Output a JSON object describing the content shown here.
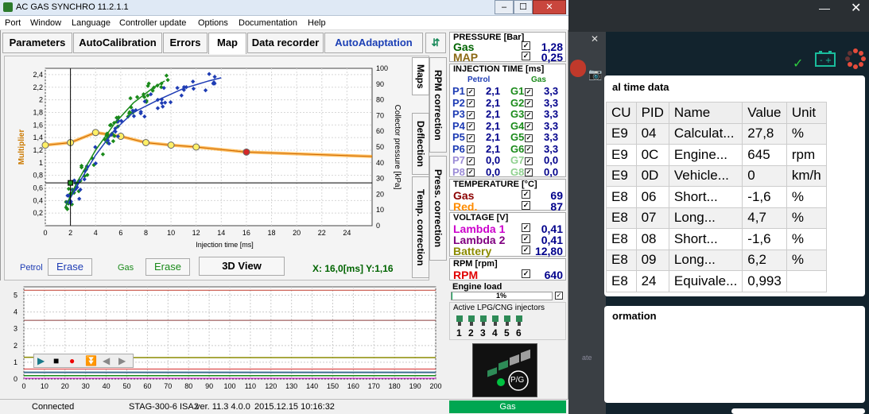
{
  "window": {
    "title": "AC GAS SYNCHRO  11.2.1.1"
  },
  "menu": [
    "Port",
    "Window",
    "Language",
    "Controller update",
    "Options",
    "Documentation",
    "Help"
  ],
  "tabs": [
    "Parameters",
    "AutoCalibration",
    "Errors",
    "Map",
    "Data recorder",
    "AutoAdaptation"
  ],
  "side_tabs": [
    "Maps",
    "RPM correction",
    "Deflection",
    "Press. correction",
    "Temp. correction"
  ],
  "chart_data": {
    "type": "scatter",
    "xlabel": "Injection time [ms]",
    "ylabel_left": "Multiplier",
    "ylabel_right": "Collector pressure [kPa]",
    "xlim": [
      0,
      26
    ],
    "ylim_left": [
      0,
      2.5
    ],
    "ylim_right": [
      0,
      100
    ],
    "x_ticks": [
      0,
      2,
      4,
      6,
      8,
      10,
      12,
      14,
      16,
      18,
      20,
      22,
      24
    ],
    "y_ticks_left": [
      0.2,
      0.4,
      0.6,
      0.8,
      1,
      1.2,
      1.4,
      1.6,
      1.8,
      2,
      2.2,
      2.4
    ],
    "y_ticks_right": [
      0,
      10,
      20,
      30,
      40,
      50,
      60,
      70,
      80,
      90,
      100
    ],
    "multiplier_curve": {
      "x": [
        0,
        2,
        4,
        6,
        8,
        10,
        12,
        16,
        26
      ],
      "y": [
        1.28,
        1.32,
        1.48,
        1.42,
        1.32,
        1.28,
        1.25,
        1.17,
        1.1
      ]
    },
    "petrol_curve": {
      "x": [
        1.6,
        2.5,
        4,
        5.5,
        7,
        9,
        11,
        13,
        14
      ],
      "y": [
        0.3,
        0.62,
        1.12,
        1.52,
        1.8,
        2.0,
        2.18,
        2.3,
        2.35
      ]
    },
    "gas_curve": {
      "x": [
        1.6,
        2.5,
        4,
        5.5,
        7,
        8.5,
        9.5
      ],
      "y": [
        0.3,
        0.68,
        1.2,
        1.62,
        1.95,
        2.18,
        2.3
      ]
    },
    "cursor": {
      "x": 2,
      "y": 0.68
    }
  },
  "chart_controls": {
    "petrol_label": "Petrol",
    "petrol_erase": "Erase",
    "gas_label": "Gas",
    "gas_erase": "Erase",
    "view_3d": "3D View",
    "readout": "X: 16,0[ms] Y:1,16"
  },
  "graph2": {
    "x_ticks": [
      0,
      10,
      20,
      30,
      40,
      50,
      60,
      70,
      80,
      90,
      100,
      110,
      120,
      130,
      140,
      150,
      160,
      170,
      180,
      190,
      200
    ],
    "y_ticks": [
      0,
      1,
      2,
      3,
      4,
      5
    ]
  },
  "pressure": {
    "title": "PRESSURE [Bar]",
    "rows": [
      {
        "label": "Gas",
        "value": "1,28",
        "color": "#006400"
      },
      {
        "label": "MAP",
        "value": "0,25",
        "color": "#8b6914"
      }
    ]
  },
  "injection": {
    "title": "INJECTION TIME [ms]",
    "petrol_label": "Petrol",
    "gas_label": "Gas",
    "rows": [
      {
        "p": "P1",
        "pv": "2,1",
        "g": "G1",
        "gv": "3,3"
      },
      {
        "p": "P2",
        "pv": "2,1",
        "g": "G2",
        "gv": "3,3"
      },
      {
        "p": "P3",
        "pv": "2,1",
        "g": "G3",
        "gv": "3,3"
      },
      {
        "p": "P4",
        "pv": "2,1",
        "g": "G4",
        "gv": "3,3"
      },
      {
        "p": "P5",
        "pv": "2,1",
        "g": "G5",
        "gv": "3,3"
      },
      {
        "p": "P6",
        "pv": "2,1",
        "g": "G6",
        "gv": "3,3"
      },
      {
        "p": "P7",
        "pv": "0,0",
        "g": "G7",
        "gv": "0,0"
      },
      {
        "p": "P8",
        "pv": "0,0",
        "g": "G8",
        "gv": "0,0"
      }
    ]
  },
  "temperature": {
    "title": "TEMPERATURE [°C]",
    "rows": [
      {
        "label": "Gas",
        "value": "69",
        "color": "#8b0000"
      },
      {
        "label": "Red.",
        "value": "87",
        "color": "#ff8c00"
      }
    ]
  },
  "voltage": {
    "title": "VOLTAGE [V]",
    "rows": [
      {
        "label": "Lambda 1",
        "value": "0,41",
        "color": "#cc00cc"
      },
      {
        "label": "Lambda 2",
        "value": "0,41",
        "color": "#800080"
      },
      {
        "label": "Battery",
        "value": "12,80",
        "color": "#8b8b00"
      }
    ]
  },
  "rpm": {
    "title": "RPM [rpm]",
    "label": "RPM",
    "value": "640"
  },
  "engine_load": {
    "title": "Engine load",
    "value": "1%",
    "fraction": 0.01
  },
  "injectors": {
    "title": "Active LPG/CNG injectors",
    "numbers": [
      "1",
      "2",
      "3",
      "4",
      "5",
      "6"
    ]
  },
  "pg_label": "P/G",
  "status": {
    "connected": "Connected",
    "controller": "STAG-300-6 ISA2",
    "version": "ver. 11.3  4.0.0",
    "datetime": "2015.12.15 10:16:32",
    "fuel": "Gas"
  },
  "realtime": {
    "title": "al time data",
    "headers": [
      "CU",
      "PID",
      "Name",
      "Value",
      "Unit"
    ],
    "rows": [
      [
        "E9",
        "04",
        "Calculat...",
        "27,8",
        "%"
      ],
      [
        "E9",
        "0C",
        "Engine...",
        "645",
        "rpm"
      ],
      [
        "E9",
        "0D",
        "Vehicle...",
        "0",
        "km/h"
      ],
      [
        "E8",
        "06",
        "Short...",
        "-1,6",
        "%"
      ],
      [
        "E8",
        "07",
        "Long...",
        "4,7",
        "%"
      ],
      [
        "E8",
        "08",
        "Short...",
        "-1,6",
        "%"
      ],
      [
        "E8",
        "09",
        "Long...",
        "6,2",
        "%"
      ],
      [
        "E8",
        "24",
        "Equivale...",
        "0,993",
        ""
      ]
    ],
    "info_title": "ormation",
    "side_label": "ate"
  },
  "colors": {
    "petrol": "#1e3cb4",
    "gas": "#1a8a1a",
    "multiplier": "#ff9900",
    "accent": "#00a651"
  }
}
